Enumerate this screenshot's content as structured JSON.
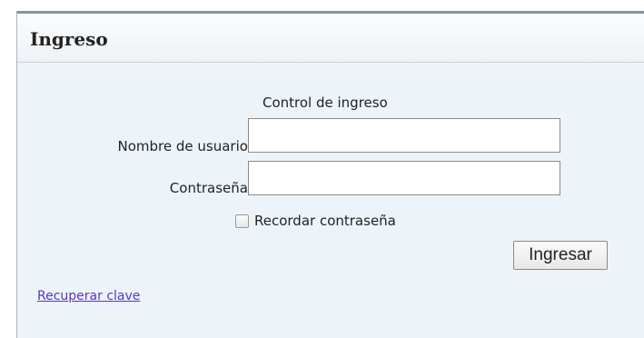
{
  "panel": {
    "title": "Ingreso"
  },
  "form": {
    "caption": "Control de ingreso",
    "username_label": "Nombre de usuario:",
    "username_value": "",
    "password_label": "Contraseña:",
    "password_value": "",
    "remember_label": "Recordar contraseña",
    "remember_checked": false,
    "submit_label": "Ingresar",
    "recover_link": "Recuperar clave"
  },
  "colors": {
    "panel_background": "#edf4f9",
    "header_border": "#7f96ad",
    "link": "#5b36b8"
  }
}
